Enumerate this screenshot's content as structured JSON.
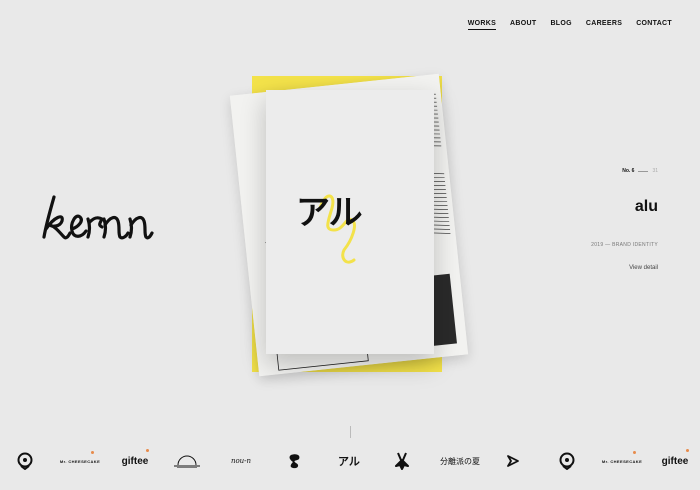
{
  "nav": {
    "items": [
      "WORKS",
      "ABOUT",
      "BLOG",
      "CAREERS",
      "CONTACT"
    ],
    "active": "WORKS"
  },
  "prev_project": {
    "wordmark": "kern"
  },
  "current": {
    "logo": "アル",
    "number": "No. 6",
    "total": "31",
    "title": "alu",
    "meta": "2019 — BRAND IDENTITY",
    "cta": "View detail"
  },
  "clients": {
    "cheesecake": "Mr. CHEESECAKE",
    "giftee": "giftee",
    "noun": "nou-n",
    "alu": "アル",
    "bunkaku": "分離派の夏"
  },
  "colors": {
    "accent": "#f3e24a",
    "background": "#e9e9e9",
    "dot": "#e78b4b"
  }
}
